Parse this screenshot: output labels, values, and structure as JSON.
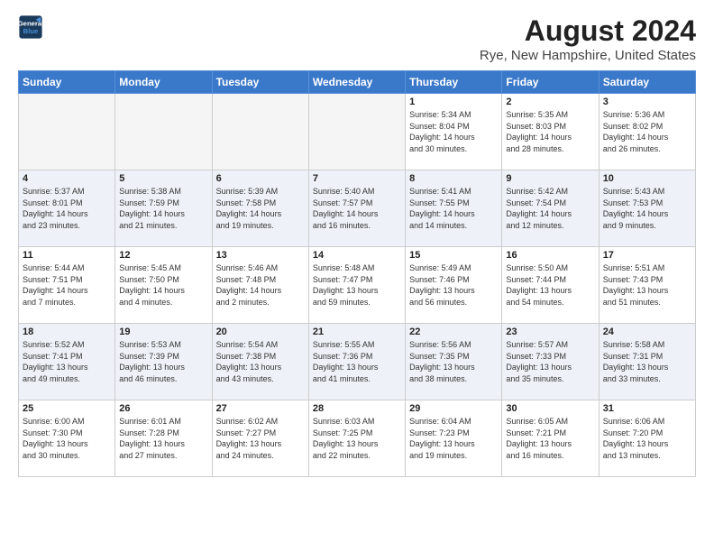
{
  "header": {
    "logo_line1": "General",
    "logo_line2": "Blue",
    "main_title": "August 2024",
    "subtitle": "Rye, New Hampshire, United States"
  },
  "weekdays": [
    "Sunday",
    "Monday",
    "Tuesday",
    "Wednesday",
    "Thursday",
    "Friday",
    "Saturday"
  ],
  "weeks": [
    [
      {
        "day": "",
        "empty": true
      },
      {
        "day": "",
        "empty": true
      },
      {
        "day": "",
        "empty": true
      },
      {
        "day": "",
        "empty": true
      },
      {
        "day": "1",
        "info": "Sunrise: 5:34 AM\nSunset: 8:04 PM\nDaylight: 14 hours\nand 30 minutes."
      },
      {
        "day": "2",
        "info": "Sunrise: 5:35 AM\nSunset: 8:03 PM\nDaylight: 14 hours\nand 28 minutes."
      },
      {
        "day": "3",
        "info": "Sunrise: 5:36 AM\nSunset: 8:02 PM\nDaylight: 14 hours\nand 26 minutes."
      }
    ],
    [
      {
        "day": "4",
        "info": "Sunrise: 5:37 AM\nSunset: 8:01 PM\nDaylight: 14 hours\nand 23 minutes."
      },
      {
        "day": "5",
        "info": "Sunrise: 5:38 AM\nSunset: 7:59 PM\nDaylight: 14 hours\nand 21 minutes."
      },
      {
        "day": "6",
        "info": "Sunrise: 5:39 AM\nSunset: 7:58 PM\nDaylight: 14 hours\nand 19 minutes."
      },
      {
        "day": "7",
        "info": "Sunrise: 5:40 AM\nSunset: 7:57 PM\nDaylight: 14 hours\nand 16 minutes."
      },
      {
        "day": "8",
        "info": "Sunrise: 5:41 AM\nSunset: 7:55 PM\nDaylight: 14 hours\nand 14 minutes."
      },
      {
        "day": "9",
        "info": "Sunrise: 5:42 AM\nSunset: 7:54 PM\nDaylight: 14 hours\nand 12 minutes."
      },
      {
        "day": "10",
        "info": "Sunrise: 5:43 AM\nSunset: 7:53 PM\nDaylight: 14 hours\nand 9 minutes."
      }
    ],
    [
      {
        "day": "11",
        "info": "Sunrise: 5:44 AM\nSunset: 7:51 PM\nDaylight: 14 hours\nand 7 minutes."
      },
      {
        "day": "12",
        "info": "Sunrise: 5:45 AM\nSunset: 7:50 PM\nDaylight: 14 hours\nand 4 minutes."
      },
      {
        "day": "13",
        "info": "Sunrise: 5:46 AM\nSunset: 7:48 PM\nDaylight: 14 hours\nand 2 minutes."
      },
      {
        "day": "14",
        "info": "Sunrise: 5:48 AM\nSunset: 7:47 PM\nDaylight: 13 hours\nand 59 minutes."
      },
      {
        "day": "15",
        "info": "Sunrise: 5:49 AM\nSunset: 7:46 PM\nDaylight: 13 hours\nand 56 minutes."
      },
      {
        "day": "16",
        "info": "Sunrise: 5:50 AM\nSunset: 7:44 PM\nDaylight: 13 hours\nand 54 minutes."
      },
      {
        "day": "17",
        "info": "Sunrise: 5:51 AM\nSunset: 7:43 PM\nDaylight: 13 hours\nand 51 minutes."
      }
    ],
    [
      {
        "day": "18",
        "info": "Sunrise: 5:52 AM\nSunset: 7:41 PM\nDaylight: 13 hours\nand 49 minutes."
      },
      {
        "day": "19",
        "info": "Sunrise: 5:53 AM\nSunset: 7:39 PM\nDaylight: 13 hours\nand 46 minutes."
      },
      {
        "day": "20",
        "info": "Sunrise: 5:54 AM\nSunset: 7:38 PM\nDaylight: 13 hours\nand 43 minutes."
      },
      {
        "day": "21",
        "info": "Sunrise: 5:55 AM\nSunset: 7:36 PM\nDaylight: 13 hours\nand 41 minutes."
      },
      {
        "day": "22",
        "info": "Sunrise: 5:56 AM\nSunset: 7:35 PM\nDaylight: 13 hours\nand 38 minutes."
      },
      {
        "day": "23",
        "info": "Sunrise: 5:57 AM\nSunset: 7:33 PM\nDaylight: 13 hours\nand 35 minutes."
      },
      {
        "day": "24",
        "info": "Sunrise: 5:58 AM\nSunset: 7:31 PM\nDaylight: 13 hours\nand 33 minutes."
      }
    ],
    [
      {
        "day": "25",
        "info": "Sunrise: 6:00 AM\nSunset: 7:30 PM\nDaylight: 13 hours\nand 30 minutes."
      },
      {
        "day": "26",
        "info": "Sunrise: 6:01 AM\nSunset: 7:28 PM\nDaylight: 13 hours\nand 27 minutes."
      },
      {
        "day": "27",
        "info": "Sunrise: 6:02 AM\nSunset: 7:27 PM\nDaylight: 13 hours\nand 24 minutes."
      },
      {
        "day": "28",
        "info": "Sunrise: 6:03 AM\nSunset: 7:25 PM\nDaylight: 13 hours\nand 22 minutes."
      },
      {
        "day": "29",
        "info": "Sunrise: 6:04 AM\nSunset: 7:23 PM\nDaylight: 13 hours\nand 19 minutes."
      },
      {
        "day": "30",
        "info": "Sunrise: 6:05 AM\nSunset: 7:21 PM\nDaylight: 13 hours\nand 16 minutes."
      },
      {
        "day": "31",
        "info": "Sunrise: 6:06 AM\nSunset: 7:20 PM\nDaylight: 13 hours\nand 13 minutes."
      }
    ]
  ]
}
